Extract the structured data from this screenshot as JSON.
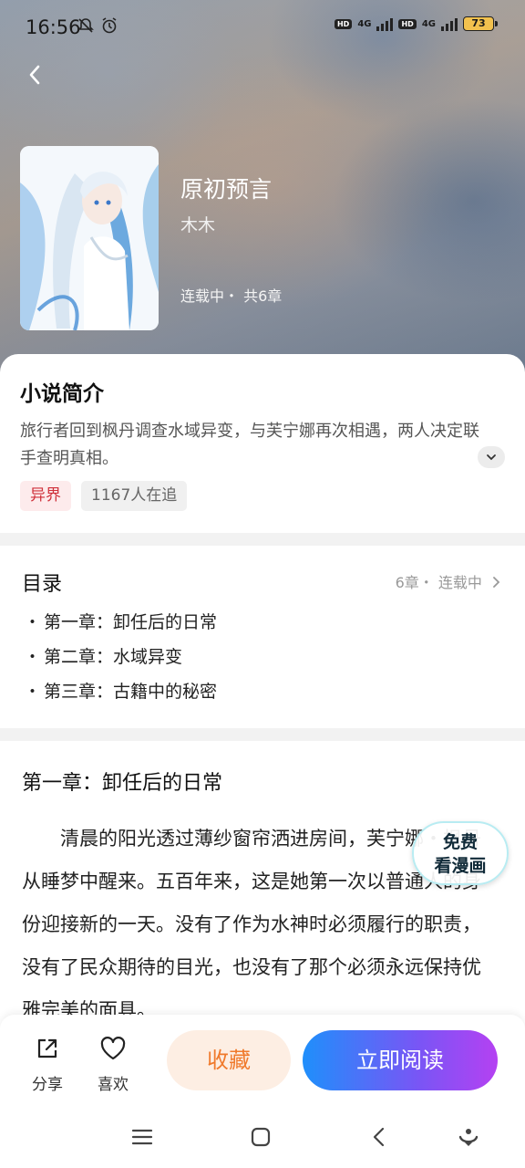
{
  "status_bar": {
    "time": "16:56",
    "network_1": "4G",
    "network_2": "4G",
    "battery": "73"
  },
  "book": {
    "title": "原初预言",
    "author": "木木",
    "meta": "连载中・ 共6章"
  },
  "intro": {
    "heading": "小说简介",
    "text": "旅行者回到枫丹调查水域异变，与芙宁娜再次相遇，两人决定联手查明真相。",
    "tags": [
      {
        "label": "异界"
      },
      {
        "label": "1167人在追"
      }
    ]
  },
  "catalog": {
    "heading": "目录",
    "meta": "6章・ 连载中",
    "chapters": [
      {
        "title": "第一章：卸任后的日常"
      },
      {
        "title": "第二章：水域异变"
      },
      {
        "title": "第三章：古籍中的秘密"
      }
    ]
  },
  "reader": {
    "chapter_title": "第一章：卸任后的日常",
    "text": "清晨的阳光透过薄纱窗帘洒进房间，芙宁娜・枫丹从睡梦中醒来。五百年来，这是她第一次以普通人的身份迎接新的一天。没有了作为水神时必须履行的职责，没有了民众期待的目光，也没有了那个必须永远保持优雅完美的面具。"
  },
  "float_badge": {
    "line1": "免费",
    "line2": "看漫画"
  },
  "actions": {
    "share_label": "分享",
    "like_label": "喜欢",
    "favorite_label": "收藏",
    "read_label": "立即阅读"
  },
  "colors": {
    "tag_genre_text": "#d0313b",
    "favorite_text": "#f07a2c",
    "read_gradient_start": "#1f8ffb",
    "read_gradient_end": "#b541f2"
  }
}
